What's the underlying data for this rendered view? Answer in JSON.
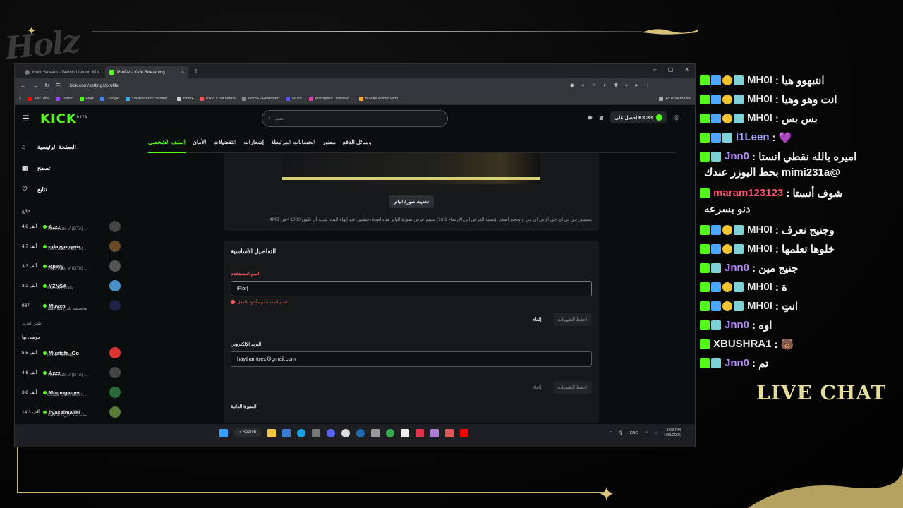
{
  "overlay": {
    "logo": "Holz",
    "live_chat": "LIVE CHAT"
  },
  "browser": {
    "tabs": [
      {
        "label": "Holz Stream - Watch Live on Ki",
        "close": "×"
      },
      {
        "label": "Profile - Kick Streaming",
        "close": "×"
      }
    ],
    "new_tab": "+",
    "url": "kick.com/settings/profile",
    "bookmarks": [
      "YouTube",
      "Twitch",
      "Holz",
      "Google",
      "Dashboard / Stream...",
      "Botfix",
      "Pixel Chat Home",
      "Home - Restream",
      "Music",
      "Instagram Downloa...",
      "Buildle Arabic Word..."
    ],
    "all_bookmarks": "All Bookmarks"
  },
  "kick": {
    "logo": "KICK",
    "logo_sup": "BETA",
    "search_placeholder": "بحث",
    "get_kicks": "احصل على KICKs",
    "nav": [
      {
        "label": "الصفحة الرئيسية",
        "icon": "home-icon"
      },
      {
        "label": "تصفح",
        "icon": "browse-icon"
      },
      {
        "label": "تتابع",
        "icon": "heart-icon"
      }
    ],
    "following_title": "تتابع",
    "following": [
      {
        "viewers": "4.8 ألف",
        "name": "Azzz",
        "game": "Theft Auto V (GTA) ..."
      },
      {
        "viewers": "4.7 ألف",
        "name": "odayyouyou",
        "game": "Theft Auto V (GTA) ..."
      },
      {
        "viewers": "3.3 ألف",
        "name": "RpWy",
        "game": "Theft Auto V (GTA) ..."
      },
      {
        "viewers": "3.2 ألف",
        "name": "YZNSA",
        "game": "Marvel Rivals"
      },
      {
        "viewers": "937",
        "name": "Muvxn",
        "game": "مخصصة للدردشة فقط"
      }
    ],
    "show_more": "أظهر المزيد",
    "recommended_title": "موصى بها",
    "recommended": [
      {
        "viewers": "5.5 ألف",
        "name": "Mustafa_Go",
        "game": "PUBG Mobile"
      },
      {
        "viewers": "4.6 ألف",
        "name": "Azzz",
        "game": "Theft Auto V (GTA) ..."
      },
      {
        "viewers": "3.8 ألف",
        "name": "Momogamer",
        "game": "Global Domination ..."
      },
      {
        "viewers": "14.3 ألف",
        "name": "ilyaselmaliki",
        "game": "مخصصة للدردشة فقط"
      }
    ],
    "settings_tabs": [
      "الملف الشخصي",
      "الأمان",
      "التفضيلات",
      "إشعارات",
      "الحسابات المرتبطة",
      "مطور",
      "وسائل الدفع"
    ],
    "banner_button": "تحديث صورة البانر",
    "banner_note": "بتنسيق جي بي اي جي أو بي ان جي و بحجم أصغر ،(نسبة العرض إلى الارتفاع 16:9) سيتم عرض صورة البانر هذه لمدة دقيقتين عند إنهاء البث. يجب أن تكون 1080 ×من 4MB.",
    "basic_title": "التفاصيل الأساسية",
    "username_label": "اسم المستخدم",
    "username_value": "iRor|",
    "username_error": "اسم المستخدم مأخوذ بالفعل",
    "cancel": "إلغاء",
    "save": "احفظ التغييرات",
    "email_label": "البريد الإلكتروني",
    "email_value": "haythamtrex@gmail.com",
    "bio_label": "السيرة الذاتية"
  },
  "taskbar": {
    "search": "Search",
    "lang": "ENG",
    "time": "8:03 PM",
    "date": "4/23/2026"
  },
  "chat": {
    "messages": [
      {
        "badges": [
          "k",
          "b",
          "g",
          "s"
        ],
        "user": "MH0I",
        "text": ": انتبهوو هيا"
      },
      {
        "badges": [
          "k",
          "b",
          "g",
          "s"
        ],
        "user": "MH0I",
        "text": ": انت وهو وهيا"
      },
      {
        "badges": [
          "k",
          "b",
          "g",
          "s"
        ],
        "user": "MH0I",
        "text": ": بس بس"
      },
      {
        "badges": [
          "k",
          "b",
          "s"
        ],
        "user": "l1Leen",
        "text": ": 💜"
      },
      {
        "badges": [
          "k",
          "s"
        ],
        "user": "Jnn0",
        "text": ": اميره بالله نقطي انستا"
      },
      {
        "badges": [],
        "user": "",
        "text": "@mimi231a بحط اليوزر عندك"
      },
      {
        "badges": [
          "k"
        ],
        "user": "maram123123",
        "text": ": شوف أنستا"
      },
      {
        "badges": [],
        "user": "",
        "text": "دنو بسرعه"
      },
      {
        "badges": [
          "k",
          "b",
          "g",
          "s"
        ],
        "user": "MH0I",
        "text": ": وجنيج تعرف"
      },
      {
        "badges": [
          "k",
          "b",
          "g",
          "s"
        ],
        "user": "MH0I",
        "text": ": خلوها تعلمها"
      },
      {
        "badges": [
          "k",
          "s"
        ],
        "user": "Jnn0",
        "text": ": جنيج مين"
      },
      {
        "badges": [
          "k",
          "b",
          "g",
          "s"
        ],
        "user": "MH0I",
        "text": ": ة"
      },
      {
        "badges": [
          "k",
          "b",
          "g",
          "s"
        ],
        "user": "MH0I",
        "text": ": انتِ"
      },
      {
        "badges": [
          "k",
          "s"
        ],
        "user": "Jnn0",
        "text": ": اوه"
      },
      {
        "badges": [
          "k"
        ],
        "user": "XBUSHRA1",
        "text": ": 🐻"
      },
      {
        "badges": [
          "k",
          "s"
        ],
        "user": "Jnn0",
        "text": ": تم"
      }
    ],
    "colors": {
      "MH0I": "#e8e8e8",
      "l1Leen": "#9fa7ff",
      "Jnn0": "#b98cff",
      "maram123123": "#ff4f6a",
      "XBUSHRA1": "#e8e8e8"
    }
  }
}
